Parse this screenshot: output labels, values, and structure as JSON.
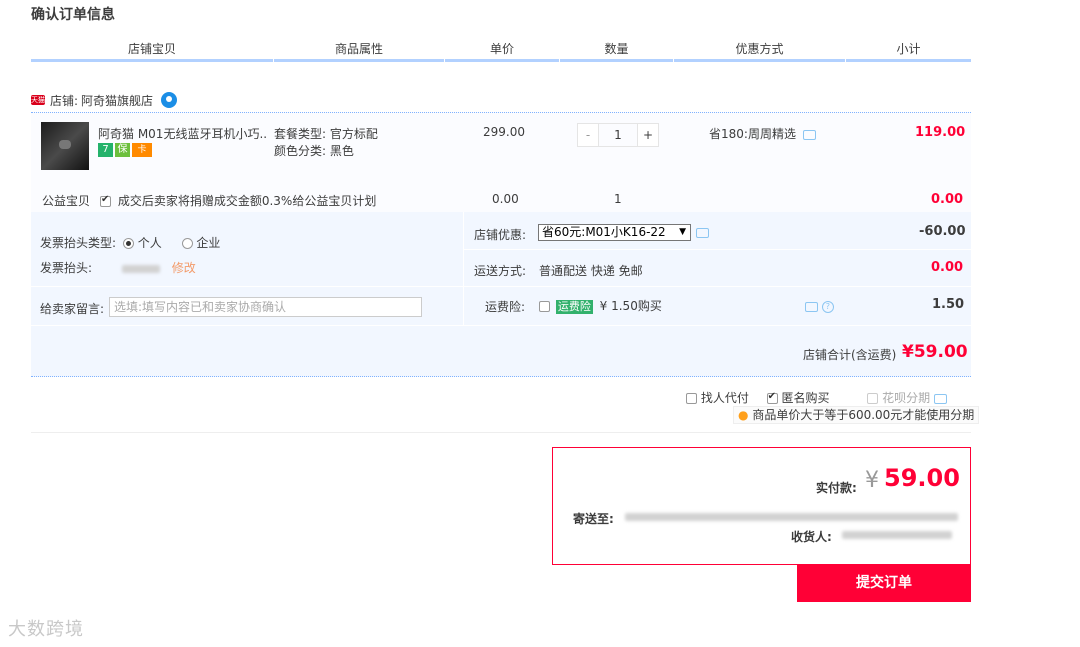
{
  "page": {
    "title": "确认订单信息"
  },
  "table_header": {
    "col_item": "店铺宝贝",
    "col_attr": "商品属性",
    "col_price": "单价",
    "col_qty": "数量",
    "col_discount": "优惠方式",
    "col_subtotal": "小计"
  },
  "shop": {
    "badge": "天猫",
    "label": "店铺:",
    "name": "阿奇猫旗舰店",
    "badge_color": "#d9001b"
  },
  "item": {
    "name": "阿奇猫 M01无线蓝牙耳机小巧...",
    "attr_package": "套餐类型: 官方标配",
    "attr_color": "颜色分类: 黑色",
    "unit_price": "299.00",
    "quantity": "1",
    "qty_minus": "-",
    "qty_plus": "+",
    "discount": "省180:周周精选",
    "subtotal": "119.00",
    "service_badges": [
      "7",
      "保",
      "卡"
    ]
  },
  "charity": {
    "label": "公益宝贝",
    "text": "成交后卖家将捐赠成交金额0.3%给公益宝贝计划",
    "price": "0.00",
    "qty": "1",
    "subtotal": "0.00"
  },
  "invoice": {
    "type_label": "发票抬头类型:",
    "opt_person": "个人",
    "opt_company": "企业",
    "head_label": "发票抬头:",
    "edit_link": "修改"
  },
  "shop_discount": {
    "label": "店铺优惠:",
    "selected": "省60元:M01小K16-22",
    "amount": "-60.00"
  },
  "shipping": {
    "label": "运送方式:",
    "value": "普通配送 快递 免邮",
    "amount": "0.00"
  },
  "message": {
    "label": "给卖家留言:",
    "placeholder": "选填:填写内容已和卖家协商确认"
  },
  "freight_insurance": {
    "label": "运费险:",
    "badge": "运费险",
    "text": "¥ 1.50购买",
    "amount": "1.50"
  },
  "shop_total": {
    "label": "店铺合计(含运费)",
    "amount": "¥59.00"
  },
  "options": {
    "proxy_pay": "找人代付",
    "anonymous": "匿名购买",
    "installment": "花呗分期",
    "installment_note": "商品单价大于等于600.00元才能使用分期"
  },
  "payment": {
    "label": "实付款:",
    "currency": "¥",
    "amount": "59.00",
    "ship_to_label": "寄送至:",
    "receiver_label": "收货人:"
  },
  "submit": {
    "label": "提交订单"
  },
  "watermark": {
    "text": "大数跨境"
  },
  "colors": {
    "accent_red": "#ff0036",
    "blue_line": "#b2d1ff",
    "band_bg": "#f2f7ff"
  }
}
